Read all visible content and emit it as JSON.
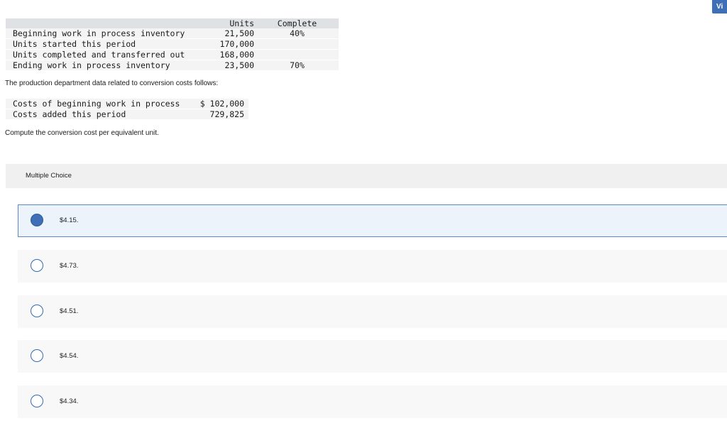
{
  "top_button": {
    "label": "Vi"
  },
  "units_table": {
    "headers": {
      "units": "Units",
      "complete": "Complete"
    },
    "rows": [
      {
        "label": "Beginning work in process inventory",
        "units": "21,500",
        "complete": "40%"
      },
      {
        "label": "Units started this period",
        "units": "170,000",
        "complete": ""
      },
      {
        "label": "Units completed and transferred out",
        "units": "168,000",
        "complete": ""
      },
      {
        "label": "Ending work in process inventory",
        "units": "23,500",
        "complete": "70%"
      }
    ]
  },
  "conversion_intro": "The production department data related to conversion costs follows:",
  "cost_table": {
    "rows": [
      {
        "label": "Costs of beginning work in process",
        "value": "$ 102,000"
      },
      {
        "label": "Costs added this period",
        "value": "729,825"
      }
    ]
  },
  "question": "Compute the conversion cost per equivalent unit.",
  "multiple_choice": {
    "header": "Multiple Choice",
    "options": [
      {
        "text": "$4.15.",
        "selected": true
      },
      {
        "text": "$4.73.",
        "selected": false
      },
      {
        "text": "$4.51.",
        "selected": false
      },
      {
        "text": "$4.54.",
        "selected": false
      },
      {
        "text": "$4.34.",
        "selected": false
      }
    ]
  },
  "colors": {
    "accent": "#3f6fb6",
    "selected_bg": "#edf3fb",
    "header_gray": "#dfe1e4"
  }
}
